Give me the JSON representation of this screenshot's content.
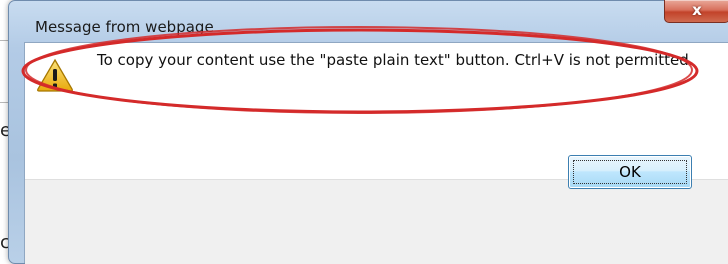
{
  "window": {
    "title": "Message from webpage",
    "close_glyph": "x"
  },
  "dialog": {
    "message": "To copy your content use the \"paste plain text\" button.  Ctrl+V is not permitted.",
    "icon": "warning-icon",
    "ok_label": "OK"
  },
  "background": {
    "partial_char_1": "e",
    "partial_char_2": "c"
  },
  "colors": {
    "annotation_ellipse": "#d42a2a",
    "warning_fill": "#f5c518",
    "close_button": "#c94a32"
  }
}
